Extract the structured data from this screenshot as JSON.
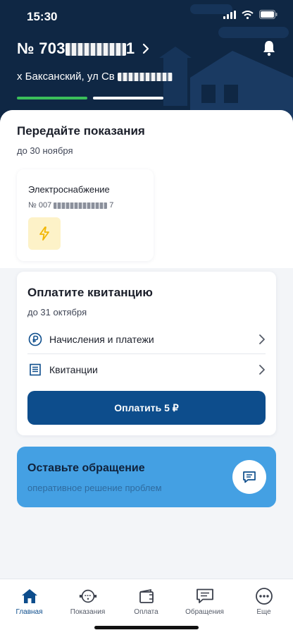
{
  "status_bar": {
    "time": "15:30"
  },
  "header": {
    "account_prefix": "№ 703",
    "account_suffix": "1",
    "address_prefix": "х Баксанский, ул Св"
  },
  "readings": {
    "title": "Передайте показания",
    "deadline": "до 30 ноября",
    "meter": {
      "title": "Электроснабжение",
      "number_prefix": "№ 007",
      "number_suffix": "7",
      "icon": "lightning-icon"
    }
  },
  "payment": {
    "title": "Оплатите квитанцию",
    "deadline": "до 31 октября",
    "rows": [
      {
        "label": "Начисления и платежи",
        "icon": "ruble-circle-icon"
      },
      {
        "label": "Квитанции",
        "icon": "receipt-icon"
      }
    ],
    "button_label": "Оплатить 5 ₽"
  },
  "appeal": {
    "title": "Оставьте обращение",
    "subtitle": "оперативное решение проблем",
    "icon": "message-icon"
  },
  "tabs": [
    {
      "label": "Главная",
      "icon": "home-icon",
      "active": true
    },
    {
      "label": "Показания",
      "icon": "meter-icon",
      "active": false
    },
    {
      "label": "Оплата",
      "icon": "wallet-icon",
      "active": false
    },
    {
      "label": "Обращения",
      "icon": "chat-icon",
      "active": false
    },
    {
      "label": "Еще",
      "icon": "more-icon",
      "active": false
    }
  ],
  "colors": {
    "header_bg": "#0f2744",
    "accent": "#0d4d8c",
    "appeal_bg": "#44a0e3",
    "progress_green": "#3bbf5a",
    "meter_icon_bg": "#fdf2c8"
  }
}
